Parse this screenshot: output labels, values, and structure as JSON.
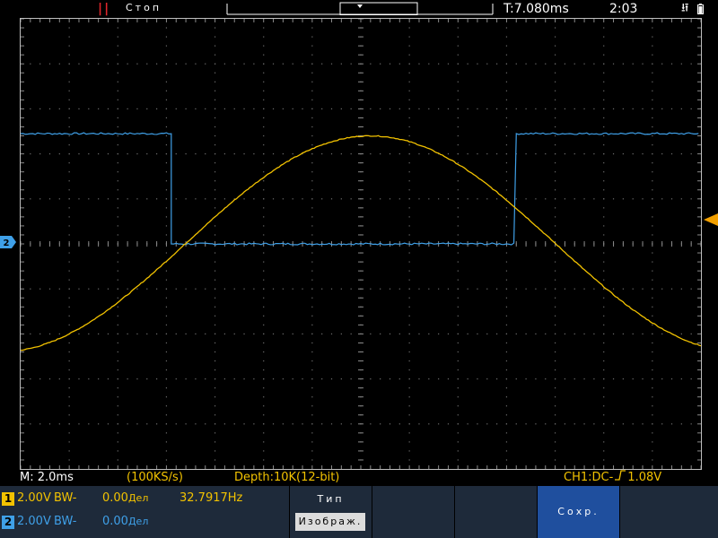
{
  "status": {
    "run_state_icon": "pause-icon",
    "run_state": "Стоп",
    "trigger_time": "T:7.080ms",
    "clock": "2:03",
    "usb_icon": "usb-icon"
  },
  "trigger_marker": "T",
  "channel2_marker": "2",
  "info_line": {
    "timebase": "M: 2.0ms",
    "sample_rate": "(100KS/s)",
    "depth": "Depth:10K(12-bit)",
    "trigger_prefix": "CH1:DC-",
    "trigger_edge_icon": "rising-edge-icon",
    "trigger_level": "1.08V"
  },
  "channels": [
    {
      "num": "1",
      "volts": "2.00V",
      "bw": "BW-",
      "offset": "0.00",
      "offset_unit": "Дел",
      "frequency": "32.7917Hz"
    },
    {
      "num": "2",
      "volts": "2.00V",
      "bw": "BW-",
      "offset": "0.00",
      "offset_unit": "Дел"
    }
  ],
  "menu": {
    "type_label": "Тип",
    "type_value": "Изображ.",
    "save_label": "Сохр."
  },
  "colors": {
    "ch1": "#f2c200",
    "ch2": "#3fa0e8",
    "trigger": "#f2a000",
    "menu_bg": "#1e2a3a",
    "menu_active": "#1f4f9e"
  },
  "waveforms": {
    "horizontal_divisions": 14,
    "vertical_divisions": 10,
    "ch1_sine": {
      "description_free": true,
      "amplitude_div": 2.4,
      "offset_div": 0,
      "period_div": 15.25,
      "phase_peak_div": 7.2
    },
    "ch2_square": {
      "high_div": 2.45,
      "low_div": 0,
      "fall_div": 3.1,
      "rise_div": 10.2
    }
  }
}
